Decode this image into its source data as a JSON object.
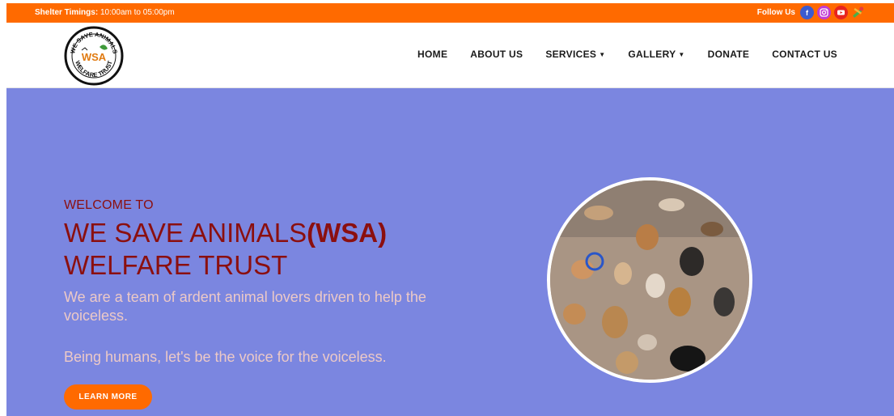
{
  "topbar": {
    "timings_label": "Shelter Timings:",
    "timings_value": "10:00am to 05:00pm",
    "follow_label": "Follow Us",
    "social": [
      "facebook-icon",
      "instagram-icon",
      "youtube-icon",
      "tools-icon"
    ]
  },
  "logo": {
    "top_text": "WE SAVE ANIMALS",
    "mid_text": "WSA",
    "bottom_text": "WELFARE TRUST"
  },
  "nav": {
    "home": "HOME",
    "about": "ABOUT US",
    "services": "SERVICES",
    "gallery": "GALLERY",
    "donate": "DONATE",
    "contact": "CONTACT US"
  },
  "hero": {
    "welcome": "WELCOME TO",
    "title_line1_a": "WE SAVE ANIMALS",
    "title_line1_b": "(WSA)",
    "title_line2": "WELFARE TRUST",
    "tagline": "We are a team of ardent animal lovers driven to help the voiceless.",
    "tagline2": "Being humans, let's be the voice for the voiceless.",
    "cta": "LEARN MORE"
  },
  "colors": {
    "accent": "#ff6a00",
    "hero_bg": "#7b86e0",
    "title": "#8b0f0f",
    "tagline": "#ecc9c7"
  }
}
